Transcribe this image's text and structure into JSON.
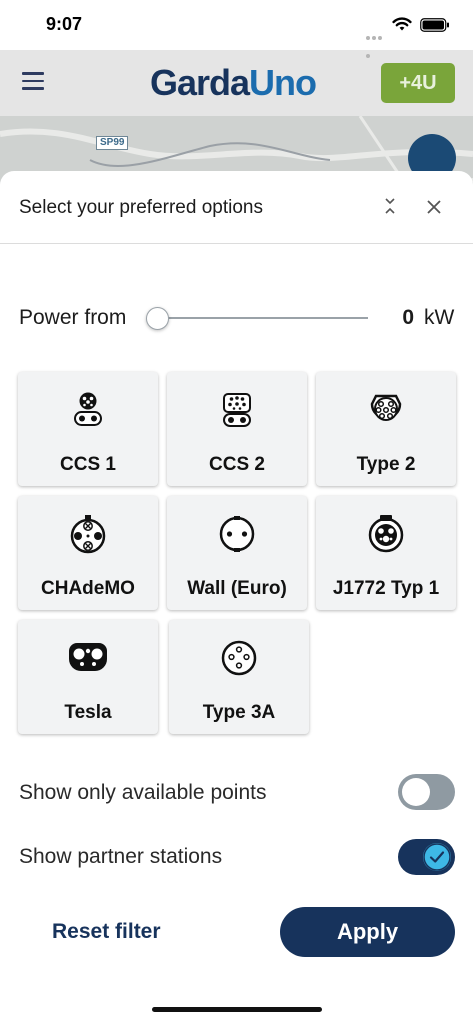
{
  "status_bar": {
    "time": "9:07"
  },
  "header": {
    "brand_part1": "Garda",
    "brand_part2": "Uno",
    "plus_button": "+4U"
  },
  "map": {
    "road_label": "SP99"
  },
  "sheet": {
    "title": "Select your preferred options",
    "power": {
      "label": "Power from",
      "value": 0,
      "value_text": "0",
      "unit": "kW",
      "slider_fraction": 0
    },
    "connectors": [
      {
        "label": "CCS 1",
        "icon": "ccs1-icon"
      },
      {
        "label": "CCS 2",
        "icon": "ccs2-icon"
      },
      {
        "label": "Type 2",
        "icon": "type2-icon"
      },
      {
        "label": "CHAdeMO",
        "icon": "chademo-icon"
      },
      {
        "label": "Wall (Euro)",
        "icon": "wall-euro-icon"
      },
      {
        "label": "J1772 Typ 1",
        "icon": "j1772-icon"
      },
      {
        "label": "Tesla",
        "icon": "tesla-icon"
      },
      {
        "label": "Type 3A",
        "icon": "type3a-icon"
      }
    ],
    "toggles": [
      {
        "label": "Show only available points",
        "on": false
      },
      {
        "label": "Show partner stations",
        "on": true
      }
    ],
    "reset_label": "Reset filter",
    "apply_label": "Apply"
  },
  "colors": {
    "primary": "#17335c",
    "accent": "#3eb8e6",
    "plus_green": "#7aa53a",
    "card_bg": "#f2f3f4"
  }
}
